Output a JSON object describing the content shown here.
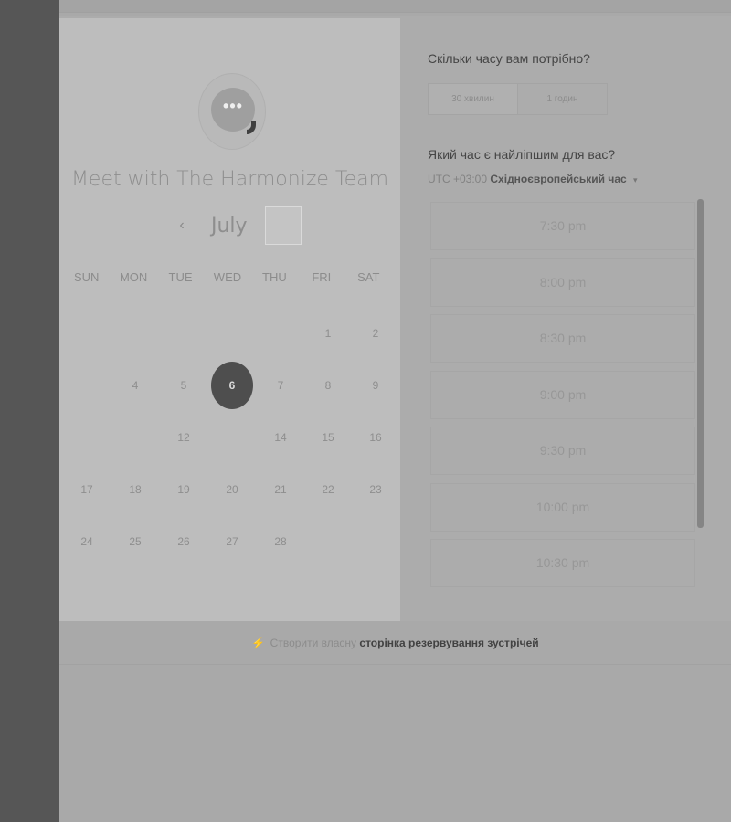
{
  "header": {
    "title": "Meet with The Harmonize Team"
  },
  "avatar": {
    "glyph": "•••"
  },
  "calendar": {
    "month": "July",
    "prev_label": "‹",
    "next_label": "",
    "weekdays": [
      "SUN",
      "MON",
      "TUE",
      "WED",
      "THU",
      "FRI",
      "SAT"
    ],
    "weeks": [
      [
        "",
        "",
        "",
        "",
        "",
        "1",
        "2"
      ],
      [
        "",
        "4",
        "5",
        "6",
        "7",
        "8",
        "9"
      ],
      [
        "",
        "",
        "12",
        "",
        "14",
        "15",
        "16"
      ],
      [
        "17",
        "18",
        "19",
        "20",
        "21",
        "22",
        "23"
      ],
      [
        "24",
        "25",
        "26",
        "27",
        "28",
        "",
        ""
      ]
    ],
    "selected": "6"
  },
  "duration": {
    "question": "Скільки часу вам потрібно?",
    "options": [
      "30 хвилин",
      "1 годин"
    ]
  },
  "time": {
    "question": "Який час є найліпшим для вас?",
    "tz_offset": "UTC +03:00",
    "tz_name": "Східноєвропейський час",
    "tz_caret": "▾",
    "slots": [
      "7:30 pm",
      "8:00 pm",
      "8:30 pm",
      "9:00 pm",
      "9:30 pm",
      "10:00 pm",
      "10:30 pm"
    ]
  },
  "footer": {
    "icon": "⚡",
    "prefix": "Створити власну",
    "link": "сторінка резервування зустрічей"
  },
  "colors": {
    "selected_day": "#4e4e4e",
    "page_bg": "#a9a9a9",
    "side_strip": "#565656"
  }
}
